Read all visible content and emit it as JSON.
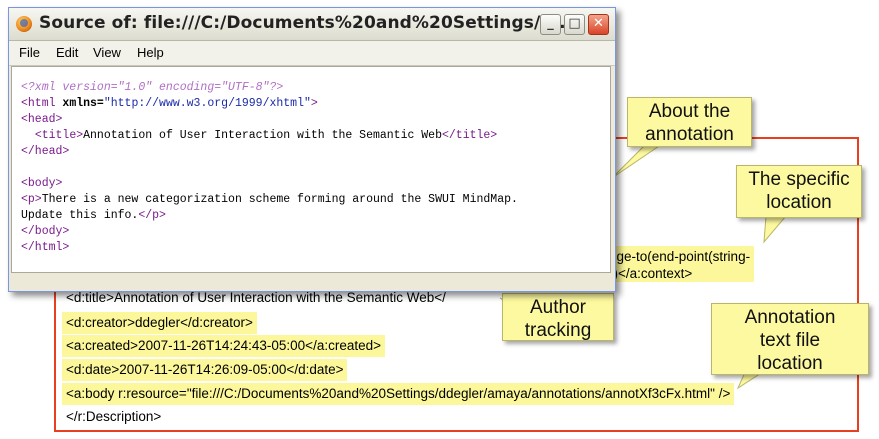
{
  "window": {
    "title": "Source of: file:///C:/Documents%20and%20Settings/d...",
    "min_glyph": "_",
    "max_glyph": "□",
    "close_glyph": "✕",
    "icon": "firefox-icon"
  },
  "menu": {
    "file": "File",
    "edit": "Edit",
    "view": "View",
    "help": "Help"
  },
  "source": {
    "xml_decl": "<?xml version=\"1.0\" encoding=\"UTF-8\"?>",
    "html_open_tag": "<html",
    "html_attr": "xmlns=",
    "html_attr_value": "\"http://www.w3.org/1999/xhtml\"",
    "html_open_close": ">",
    "head_open": "<head>",
    "title_open": "<title>",
    "title_text": "Annotation of User Interaction with the Semantic Web",
    "title_close": "</title>",
    "head_close": "</head>",
    "body_open": "<body>",
    "p_open": "<p>",
    "p_text_1": "There is a new categorization scheme forming around the SWUI MindMap.",
    "p_text_2": "Update this info.",
    "p_close": "</p>",
    "body_close": "</body>",
    "html_close": "</html>"
  },
  "annotation": {
    "context_line_1": "nge-to(end-point(string-",
    "context_line_2": "))</a:context>",
    "title_line": "<d:title>Annotation of User Interaction with the Semantic Web</",
    "creator_line": "<d:creator>ddegler</d:creator>",
    "created_line": "<a:created>2007-11-26T14:24:43-05:00</a:created>",
    "date_line": "<d:date>2007-11-26T14:26:09-05:00</d:date>",
    "body_line": "<a:body r:resource=\"file:///C:/Documents%20and%20Settings/ddegler/amaya/annotations/annotXf3cFx.html\" />",
    "description_close": "</r:Description>"
  },
  "callouts": {
    "about": "About the\nannotation",
    "location": "The specific\nlocation",
    "author": "Author\ntracking",
    "file": "Annotation\ntext file\nlocation"
  },
  "colors": {
    "frame": "#e8401f",
    "highlight": "#fbf79a",
    "callout": "#fdf9a0",
    "tag": "#7a1a8c",
    "value": "#1a2aa8"
  }
}
